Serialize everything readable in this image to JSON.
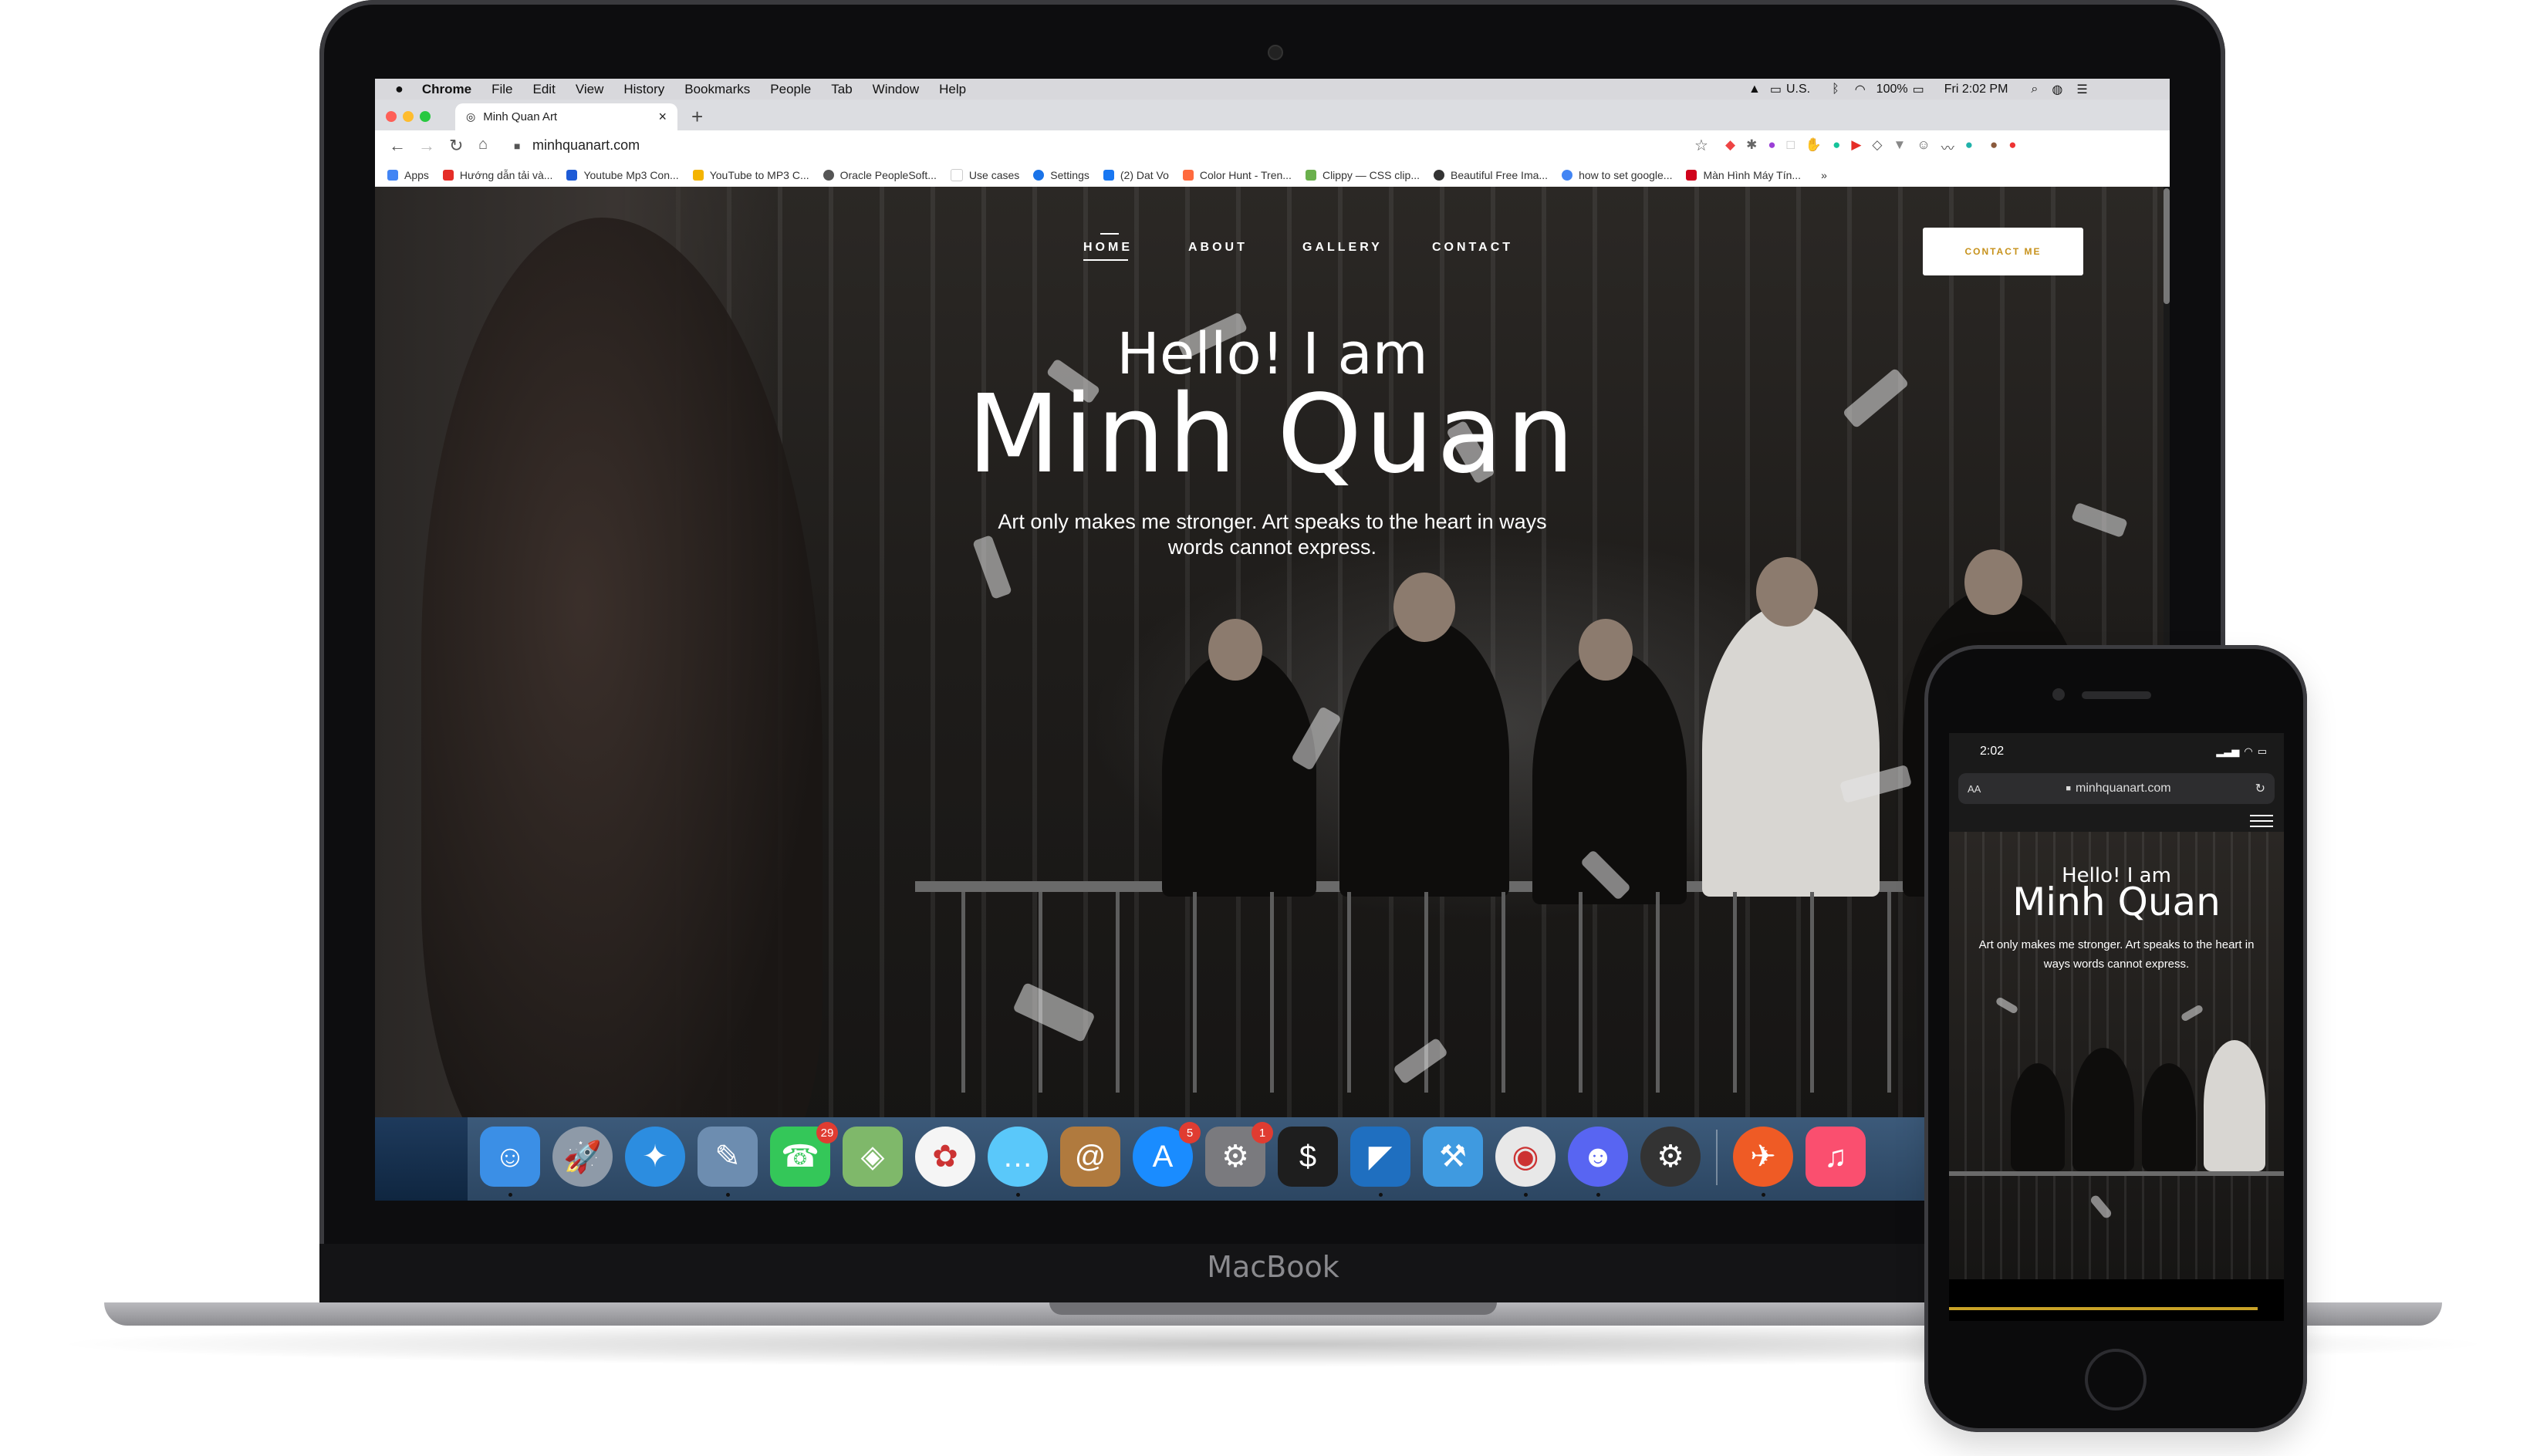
{
  "macbook": {
    "brand": "MacBook"
  },
  "menubar": {
    "app": "Chrome",
    "items": [
      "File",
      "Edit",
      "View",
      "History",
      "Bookmarks",
      "People",
      "Tab",
      "Window",
      "Help"
    ],
    "input_source": "U.S.",
    "battery": "100%",
    "clock": "Fri 2:02 PM"
  },
  "browser": {
    "tab_title": "Minh Quan Art",
    "new_tab": "+",
    "close_tab": "×",
    "url": "minhquanart.com",
    "bookmarks": [
      {
        "label": "Apps",
        "color": "#4285f4"
      },
      {
        "label": "Hướng dẫn tải và...",
        "color": "#e52d27"
      },
      {
        "label": "Youtube Mp3 Con...",
        "color": "#1e5bd6"
      },
      {
        "label": "YouTube to MP3 C...",
        "color": "#f4b400"
      },
      {
        "label": "Oracle PeopleSoft...",
        "color": "#555555"
      },
      {
        "label": "Use cases",
        "color": "#ffffff"
      },
      {
        "label": "Settings",
        "color": "#1a73e8"
      },
      {
        "label": "(2) Dat Vo",
        "color": "#1877f2"
      },
      {
        "label": "Color Hunt - Tren...",
        "color": "#ff6a3d"
      },
      {
        "label": "Clippy — CSS clip...",
        "color": "#6ab04c"
      },
      {
        "label": "Beautiful Free Ima...",
        "color": "#333333"
      },
      {
        "label": "how to set google...",
        "color": "#4285f4"
      },
      {
        "label": "Màn Hình Máy Tín...",
        "color": "#d0021b"
      }
    ],
    "bookmarks_more": "»"
  },
  "site": {
    "nav": [
      "HOME",
      "ABOUT",
      "GALLERY",
      "CONTACT"
    ],
    "contact_button": "CONTACT ME",
    "hello": "Hello! I am",
    "name": "Minh Quan",
    "tagline_line1": "Art only makes me stronger. Art speaks to the heart in ways",
    "tagline_line2": "words cannot express."
  },
  "dock": {
    "icons": [
      {
        "name": "finder-icon",
        "color": "#3b8fe6",
        "glyph": "☺"
      },
      {
        "name": "launchpad-icon",
        "color": "#8e9aa8",
        "glyph": "🚀"
      },
      {
        "name": "safari-icon",
        "color": "#2c8de0",
        "glyph": "✦"
      },
      {
        "name": "preview-icon",
        "color": "#6d8db0",
        "glyph": "✎"
      },
      {
        "name": "facetime-icon",
        "color": "#34c759",
        "glyph": "☎",
        "badge": "29"
      },
      {
        "name": "maps-icon",
        "color": "#7fb86a",
        "glyph": "◈"
      },
      {
        "name": "photos-icon",
        "color": "#f5f5f5",
        "glyph": "✿"
      },
      {
        "name": "messages-icon",
        "color": "#5ac8fa",
        "glyph": "…"
      },
      {
        "name": "contacts-icon",
        "color": "#b07a3e",
        "glyph": "@"
      },
      {
        "name": "app-store-icon",
        "color": "#1a8cff",
        "glyph": "A",
        "badge": "5"
      },
      {
        "name": "system-preferences-icon",
        "color": "#7a7a7e",
        "glyph": "⚙",
        "badge": "1"
      },
      {
        "name": "terminal-icon",
        "color": "#1e1e1e",
        "glyph": "$"
      },
      {
        "name": "vscode-icon",
        "color": "#1f6fc0",
        "glyph": "◤"
      },
      {
        "name": "xcode-icon",
        "color": "#3f9ae0",
        "glyph": "⚒"
      },
      {
        "name": "chrome-icon",
        "color": "#e8e8e8",
        "glyph": "◉"
      },
      {
        "name": "discord-icon",
        "color": "#5865f2",
        "glyph": "☻"
      },
      {
        "name": "alfred-icon",
        "color": "#333333",
        "glyph": "⚙"
      },
      {
        "name": "postman-icon",
        "color": "#ef5b25",
        "glyph": "✈"
      },
      {
        "name": "music-icon",
        "color": "#fa4f6f",
        "glyph": "♫"
      }
    ]
  },
  "phone": {
    "time": "2:02",
    "aa": "AA",
    "url": "minhquanart.com",
    "hello": "Hello! I am",
    "name": "Minh Quan",
    "tagline_line1": "Art only makes me stronger. Art speaks to the heart in",
    "tagline_line2": "ways words cannot express."
  }
}
